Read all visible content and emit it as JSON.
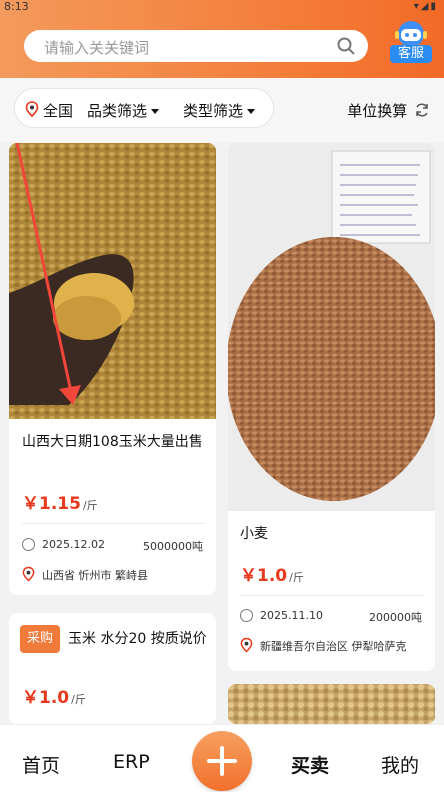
{
  "status_bar": {
    "time": "8:13"
  },
  "header": {
    "search_placeholder": "请输入关关键词",
    "customer_service_label": "客服"
  },
  "filters": {
    "region": "全国",
    "category": "品类筛选",
    "type": "类型筛选",
    "unit_convert": "单位换算"
  },
  "listings": [
    {
      "title": "山西大日期108玉米大量出售",
      "price": "￥1.15",
      "unit": "/斤",
      "date": "2025.12.02",
      "quantity": "5000000吨",
      "location": "山西省 忻州市 繁峙县"
    },
    {
      "title": "小麦",
      "price": "￥1.0",
      "unit": "/斤",
      "date": "2025.11.10",
      "quantity": "200000吨",
      "location": "新疆维吾尔自治区 伊犁哈萨克"
    },
    {
      "tag": "采购",
      "title": "玉米  水分20  按质说价",
      "price": "￥1.0",
      "unit": "/斤"
    }
  ],
  "bottom_nav": {
    "home": "首页",
    "erp": "ERP",
    "trade": "买卖",
    "mine": "我的"
  },
  "colors": {
    "accent": "#f47f3c",
    "price": "#e8391d",
    "service": "#2a8cf0"
  }
}
